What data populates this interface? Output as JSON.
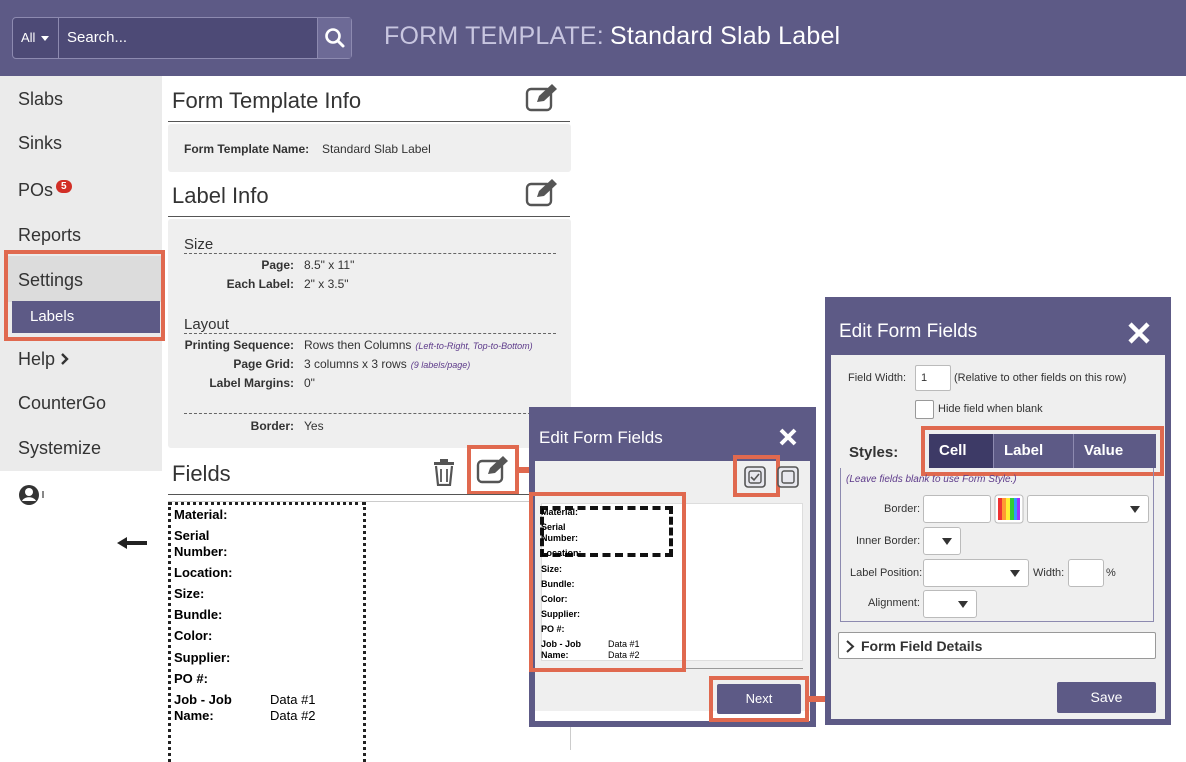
{
  "header": {
    "search_scope": "All",
    "search_placeholder": "Search...",
    "title_prefix": "FORM TEMPLATE:",
    "title_name": "Standard Slab Label"
  },
  "sidebar": {
    "items": [
      {
        "label": "Slabs"
      },
      {
        "label": "Sinks"
      },
      {
        "label": "POs",
        "badge": "5"
      },
      {
        "label": "Reports"
      },
      {
        "label": "Settings"
      },
      {
        "label": "Labels"
      },
      {
        "label": "Help"
      },
      {
        "label": "CounterGo"
      },
      {
        "label": "Systemize"
      }
    ]
  },
  "form_template_info": {
    "title": "Form Template Info",
    "name_label": "Form Template Name:",
    "name_value": "Standard Slab Label"
  },
  "label_info": {
    "title": "Label Info",
    "size_heading": "Size",
    "page_label": "Page:",
    "page_value": "8.5\" x 11\"",
    "each_label": "Each Label:",
    "each_value": "2\" x 3.5\"",
    "layout_heading": "Layout",
    "sequence_label": "Printing Sequence:",
    "sequence_value": "Rows then Columns",
    "sequence_hint": "(Left-to-Right, Top-to-Bottom)",
    "grid_label": "Page Grid:",
    "grid_value": "3 columns x 3 rows",
    "grid_hint": "(9 labels/page)",
    "margins_label": "Label Margins:",
    "margins_value": "0\"",
    "border_label": "Border:",
    "border_value": "Yes"
  },
  "fields": {
    "title": "Fields",
    "rows": [
      {
        "label": "Material:"
      },
      {
        "label": "Serial Number:"
      },
      {
        "label": "Location:"
      },
      {
        "label": "Size:"
      },
      {
        "label": "Bundle:"
      },
      {
        "label": "Color:"
      },
      {
        "label": "Supplier:"
      },
      {
        "label": "PO #:"
      },
      {
        "label": "Job - Job Name:",
        "value1": "Data #1",
        "value2": "Data #2"
      }
    ]
  },
  "modal_small": {
    "title": "Edit Form Fields",
    "next_label": "Next",
    "preview": {
      "material": "Material:",
      "serial_1": "Serial",
      "serial_2": "Number:",
      "location": "Location:",
      "size": "Size:",
      "bundle": "Bundle:",
      "color": "Color:",
      "supplier": "Supplier:",
      "po": "PO #:",
      "job_1": "Job - Job",
      "job_2": "Name:",
      "data1": "Data #1",
      "data2": "Data #2"
    }
  },
  "modal_large": {
    "title": "Edit Form Fields",
    "field_width_label": "Field Width:",
    "field_width_value": "1",
    "field_width_hint": "(Relative to other fields on this row)",
    "hide_label": "Hide field when blank",
    "styles_label": "Styles:",
    "tabs": [
      "Cell",
      "Label",
      "Value"
    ],
    "blank_hint": "(Leave fields blank to use Form Style.)",
    "border_label": "Border:",
    "inner_border_label": "Inner Border:",
    "label_position_label": "Label Position:",
    "width_label": "Width:",
    "percent": "%",
    "alignment_label": "Alignment:",
    "details_label": "Form Field Details",
    "save_label": "Save"
  },
  "colors": {
    "brand": "#5d5a86",
    "highlight": "#e0694f",
    "badge": "#d22f27"
  }
}
